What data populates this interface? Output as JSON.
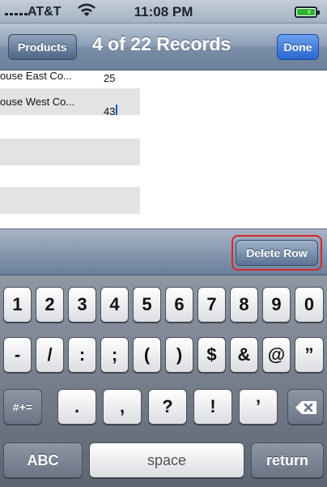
{
  "status_bar": {
    "carrier": "AT&T",
    "time": "11:08 PM",
    "icons": [
      "signal-icon",
      "wifi-icon",
      "battery-charging-icon"
    ]
  },
  "nav_bar": {
    "back_label": "Products",
    "title": "4 of 22 Records",
    "done_label": "Done"
  },
  "rows": [
    {
      "name": "ouse East Co...",
      "value": "25"
    },
    {
      "name": "ouse West Co...",
      "value": "43"
    }
  ],
  "toolbar": {
    "delete_label": "Delete Row",
    "highlight_color": "#d8282e"
  },
  "keyboard": {
    "row1": [
      "1",
      "2",
      "3",
      "4",
      "5",
      "6",
      "7",
      "8",
      "9",
      "0"
    ],
    "row2": [
      "-",
      "/",
      ":",
      ";",
      "(",
      ")",
      "$",
      "&",
      "@",
      "”"
    ],
    "row3": {
      "mode_label": "#+=",
      "keys": [
        ".",
        ",",
        "?",
        "!",
        "’"
      ],
      "backspace_icon": "backspace-icon"
    },
    "row4": {
      "abc_label": "ABC",
      "space_label": "space",
      "return_label": "return"
    }
  }
}
